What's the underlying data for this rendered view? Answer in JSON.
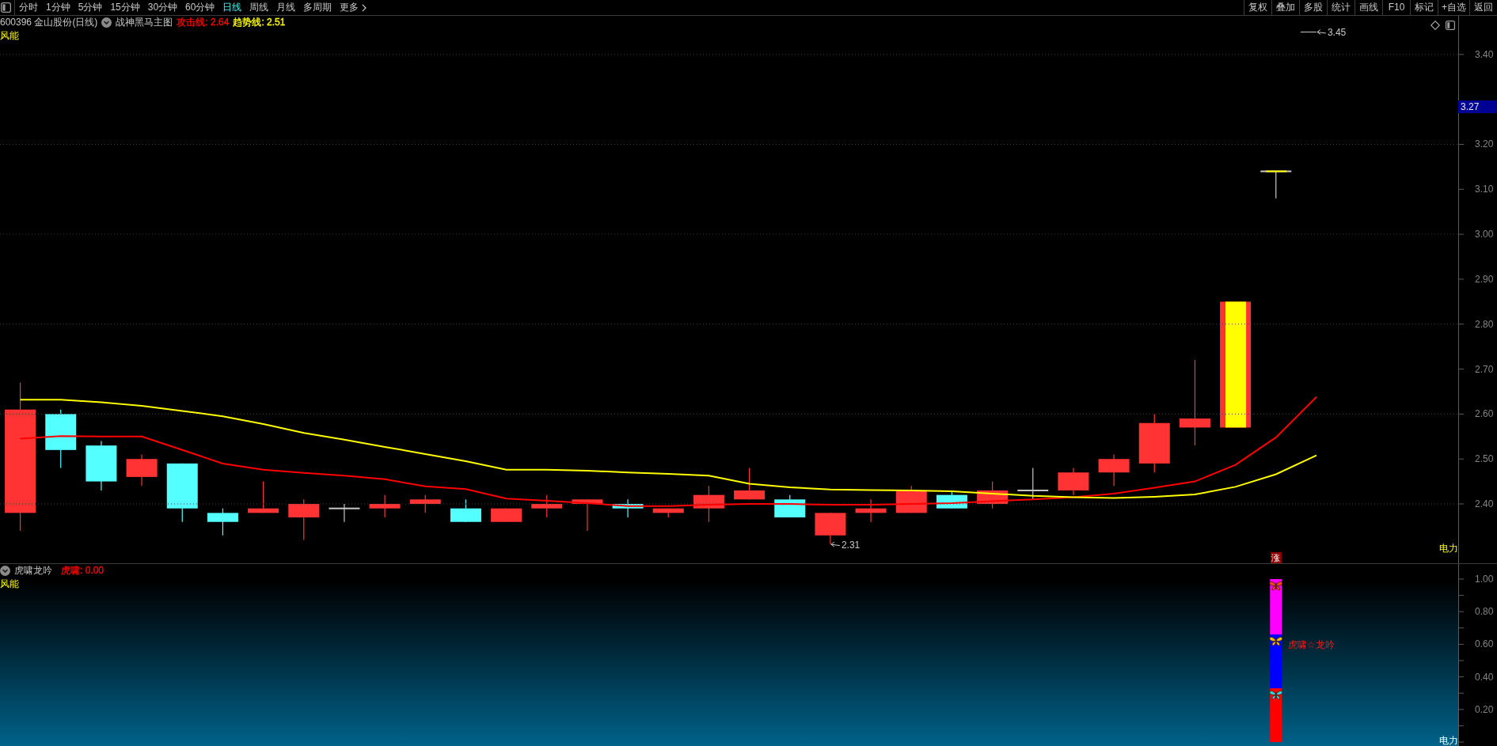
{
  "toolbar": {
    "periods": [
      {
        "label": "分时",
        "selected": false
      },
      {
        "label": "1分钟",
        "selected": false
      },
      {
        "label": "5分钟",
        "selected": false
      },
      {
        "label": "15分钟",
        "selected": false
      },
      {
        "label": "30分钟",
        "selected": false
      },
      {
        "label": "60分钟",
        "selected": false
      },
      {
        "label": "日线",
        "selected": true
      },
      {
        "label": "周线",
        "selected": false
      },
      {
        "label": "月线",
        "selected": false
      },
      {
        "label": "多周期",
        "selected": false
      }
    ],
    "more_button": "更多",
    "actions": [
      "复权",
      "叠加",
      "多股",
      "统计",
      "画线",
      "F10",
      "标记",
      "+自选",
      "返回"
    ]
  },
  "main_chart": {
    "title": "600396 金山股份(日线)",
    "indicator": "战神黑马主图",
    "legend": [
      {
        "label": "攻击线: 2.64",
        "color": "#ff0000"
      },
      {
        "label": "趋势线: 2.51",
        "color": "#ffff00"
      }
    ],
    "top_label": "风能",
    "bottom_label": "电力",
    "price_badge": "3.27",
    "limit_marker": "涨",
    "chart_data": {
      "type": "line",
      "grid": true,
      "categories": [
        null,
        null,
        null,
        null,
        null,
        null,
        null,
        null,
        null,
        null,
        null,
        null,
        null,
        null,
        null,
        null,
        null,
        null,
        null,
        null,
        null,
        null,
        null,
        null,
        null,
        null,
        null,
        null,
        null,
        null,
        null,
        null,
        null,
        null,
        null,
        null
      ],
      "ylim": [
        2.268,
        3.486
      ],
      "yticks": [
        {
          "value": 2.4,
          "label": "2.40"
        },
        {
          "value": 2.5,
          "label": "2.50"
        },
        {
          "value": 2.6,
          "label": "2.60"
        },
        {
          "value": 2.7,
          "label": "2.70"
        },
        {
          "value": 2.8,
          "label": "2.80"
        },
        {
          "value": 2.9,
          "label": "2.90"
        },
        {
          "value": 3.0,
          "label": "3.00"
        },
        {
          "value": 3.1,
          "label": "3.10"
        },
        {
          "value": 3.2,
          "label": "3.20"
        },
        {
          "value": 3.4,
          "label": "3.40"
        }
      ],
      "series": [
        {
          "color": "#ff0000",
          "values": [
            2.545,
            2.551,
            2.55,
            2.55,
            2.52,
            2.49,
            2.476,
            2.469,
            2.463,
            2.455,
            2.439,
            2.433,
            2.412,
            2.407,
            2.402,
            2.395,
            2.395,
            2.398,
            2.4,
            2.4,
            2.398,
            2.398,
            2.4,
            2.402,
            2.406,
            2.41,
            2.415,
            2.423,
            2.436,
            2.45,
            2.487,
            2.548,
            2.638,
            null,
            null,
            null
          ]
        },
        {
          "color": "#ffff00",
          "values": [
            2.632,
            2.632,
            2.626,
            2.618,
            2.607,
            2.595,
            2.578,
            2.558,
            2.543,
            2.527,
            2.511,
            2.495,
            2.476,
            2.476,
            2.474,
            2.47,
            2.467,
            2.463,
            2.445,
            2.437,
            2.432,
            2.431,
            2.43,
            2.428,
            2.423,
            2.418,
            2.415,
            2.413,
            2.416,
            2.421,
            2.438,
            2.466,
            2.508,
            null,
            null,
            null
          ]
        }
      ],
      "annotations": [
        "3.45",
        "2.31"
      ]
    }
  },
  "sub_chart": {
    "indicator": "虎啸龙吟",
    "legend": [
      {
        "label": "虎啸: 0.00",
        "color": "#ff0000"
      }
    ],
    "top_label": "风能",
    "bottom_label": "电力",
    "signal_label": "虎啸☆龙吟",
    "chart_data": {
      "type": "bar",
      "stacked": true,
      "categories": [
        null,
        null,
        null,
        null,
        null,
        null,
        null,
        null,
        null,
        null,
        null,
        null,
        null,
        null,
        null,
        null,
        null,
        null,
        null,
        null,
        null,
        null,
        null,
        null,
        null,
        null,
        null,
        null,
        null,
        null,
        null,
        null,
        null,
        null,
        null,
        null
      ],
      "ylim": [
        -0.024,
        1.092
      ],
      "yticks": [
        {
          "value": 0.2,
          "label": "0.20"
        },
        {
          "value": 0.4,
          "label": "0.40"
        },
        {
          "value": 0.6,
          "label": "0.60"
        },
        {
          "value": 0.8,
          "label": "0.80"
        },
        {
          "value": 1.0,
          "label": "1.00"
        }
      ],
      "series": [
        {
          "color": "#ff0000",
          "values": [
            null,
            null,
            null,
            null,
            null,
            null,
            null,
            null,
            null,
            null,
            null,
            null,
            null,
            null,
            null,
            null,
            null,
            null,
            null,
            null,
            null,
            null,
            null,
            null,
            null,
            null,
            null,
            null,
            null,
            null,
            null,
            0.33,
            null,
            null,
            null,
            null
          ]
        },
        {
          "color": "#0000ff",
          "values": [
            null,
            null,
            null,
            null,
            null,
            null,
            null,
            null,
            null,
            null,
            null,
            null,
            null,
            null,
            null,
            null,
            null,
            null,
            null,
            null,
            null,
            null,
            null,
            null,
            null,
            null,
            null,
            null,
            null,
            null,
            null,
            0.33,
            null,
            null,
            null,
            null
          ]
        },
        {
          "color": "#ff00ff",
          "values": [
            null,
            null,
            null,
            null,
            null,
            null,
            null,
            null,
            null,
            null,
            null,
            null,
            null,
            null,
            null,
            null,
            null,
            null,
            null,
            null,
            null,
            null,
            null,
            null,
            null,
            null,
            null,
            null,
            null,
            null,
            null,
            0.34,
            null,
            null,
            null,
            null
          ]
        }
      ]
    }
  }
}
